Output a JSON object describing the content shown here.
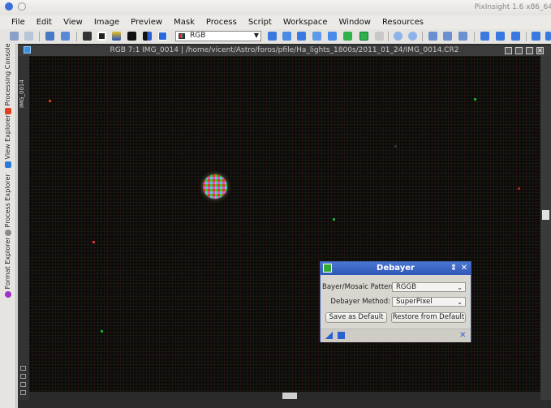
{
  "app": {
    "title": "PixInsight 1.6 x86_64"
  },
  "menu": [
    "File",
    "Edit",
    "View",
    "Image",
    "Preview",
    "Mask",
    "Process",
    "Script",
    "Workspace",
    "Window",
    "Resources"
  ],
  "toolbar": {
    "channel_value": "RGB"
  },
  "left_dock": {
    "tabs": [
      "Processing Console",
      "View Explorer",
      "Process Explorer",
      "Format Explorer"
    ]
  },
  "image_window": {
    "side_label": "IMG_0014",
    "caption": "RGB 7:1 IMG_0014 | /home/vicent/Astro/foros/pfile/Ha_lights_1800s/2011_01_24/IMG_0014.CR2"
  },
  "debayer": {
    "title": "Debayer",
    "pattern_label": "Bayer/Mosaic Pattern:",
    "pattern_value": "RGGB",
    "method_label": "Debayer Method:",
    "method_value": "SuperPixel",
    "save_default_label": "Save as Default",
    "restore_default_label": "Restore from Default"
  },
  "colors": {
    "accent": "#3a5fb0",
    "canvas": "#0b0b0b"
  }
}
